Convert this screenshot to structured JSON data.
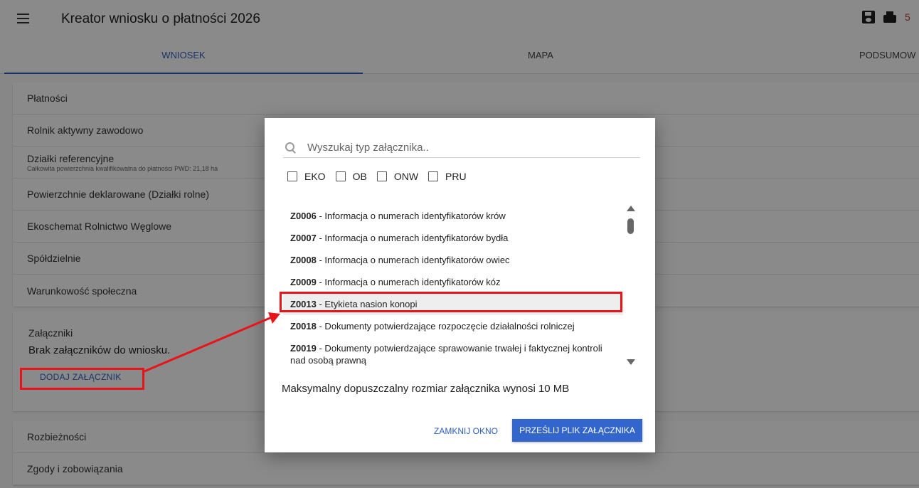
{
  "app": {
    "title": "Kreator wniosku o płatności 2026",
    "top_count": "5"
  },
  "tabs": [
    {
      "label": "WNIOSEK"
    },
    {
      "label": "MAPA"
    },
    {
      "label": "PODSUMOW"
    }
  ],
  "sections": {
    "platnosci": "Płatności",
    "rolnik": "Rolnik aktywny zawodowo",
    "dzialki": "Działki referencyjne",
    "dzialki_sub": "Całkowita powierzchnia kwalifikowalna do płatności PWD: 21,18 ha",
    "powierzchnie": "Powierzchnie deklarowane (Działki rolne)",
    "ekoschemat": "Ekoschemat Rolnictwo Węglowe",
    "spoldzielnie": "Spółdzielnie",
    "warunkowosc": "Warunkowość społeczna",
    "rozbieznosci": "Rozbieżności",
    "zgody": "Zgody i zobowiązania"
  },
  "attachments": {
    "title": "Załączniki",
    "empty_text": "Brak załączników do wniosku.",
    "add_button": "DODAJ ZAŁĄCZNIK"
  },
  "modal": {
    "search_placeholder": "Wyszukaj typ załącznika..",
    "filters": [
      "EKO",
      "OB",
      "ONW",
      "PRU"
    ],
    "items": [
      {
        "code": "Z0006",
        "desc": " - Informacja o numerach identyfikatorów krów"
      },
      {
        "code": "Z0007",
        "desc": " - Informacja o numerach identyfikatorów bydła"
      },
      {
        "code": "Z0008",
        "desc": " - Informacja o numerach identyfikatorów owiec"
      },
      {
        "code": "Z0009",
        "desc": " - Informacja o numerach identyfikatorów kóz"
      },
      {
        "code": "Z0013",
        "desc": " - Etykieta nasion konopi"
      },
      {
        "code": "Z0018",
        "desc": " - Dokumenty potwierdzające rozpoczęcie działalności rolniczej"
      },
      {
        "code": "Z0019",
        "desc": " - Dokumenty potwierdzające sprawowanie trwałej i faktycznej kontroli nad osobą prawną"
      }
    ],
    "max_size_text": "Maksymalny dopuszczalny rozmiar załącznika wynosi 10 MB",
    "close_button": "ZAMKNIJ OKNO",
    "upload_button": "PRZEŚLIJ PLIK ZAŁĄCZNIKA"
  },
  "colors": {
    "accent": "#3366cc",
    "annotation": "#e8141a"
  }
}
